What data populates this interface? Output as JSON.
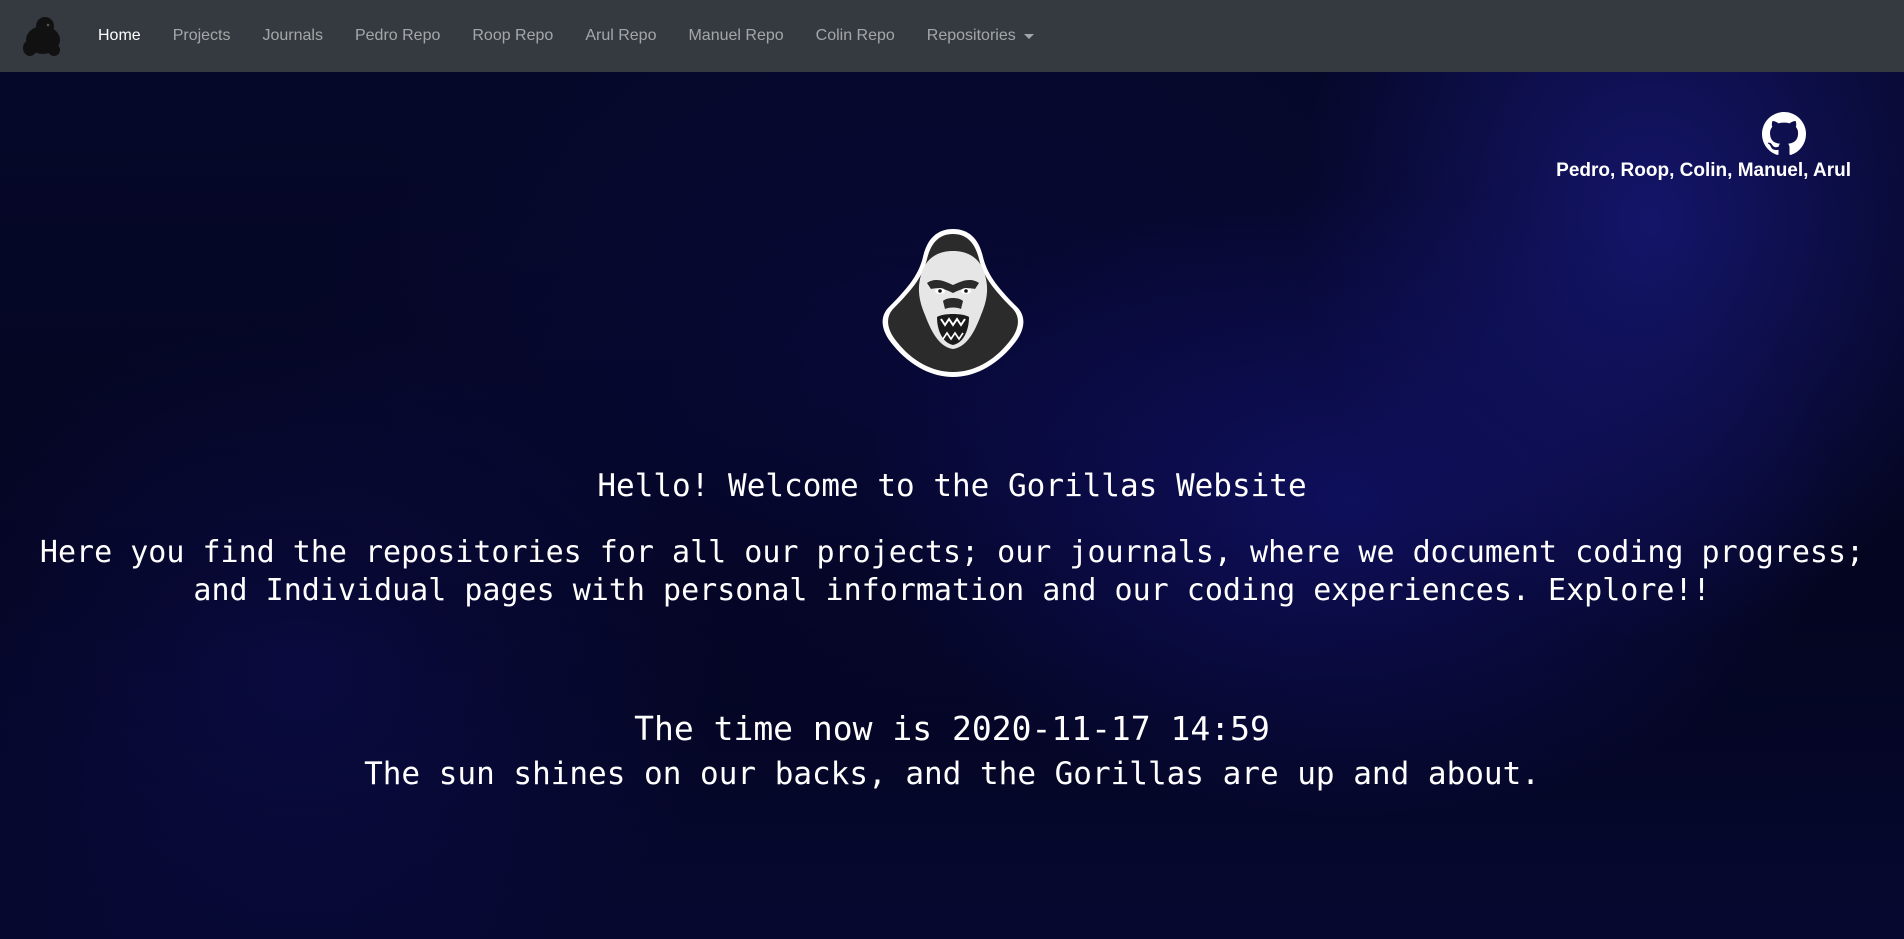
{
  "nav": {
    "brand_icon": "gorilla-icon",
    "items": [
      {
        "label": "Home",
        "active": true
      },
      {
        "label": "Projects",
        "active": false
      },
      {
        "label": "Journals",
        "active": false
      },
      {
        "label": "Pedro Repo",
        "active": false
      },
      {
        "label": "Roop Repo",
        "active": false
      },
      {
        "label": "Arul Repo",
        "active": false
      },
      {
        "label": "Manuel Repo",
        "active": false
      },
      {
        "label": "Colin Repo",
        "active": false
      }
    ],
    "dropdown_label": "Repositories"
  },
  "header": {
    "github_icon": "github-icon",
    "team": "Pedro, Roop, Colin, Manuel, Arul"
  },
  "main": {
    "logo_icon": "gorilla-logo",
    "welcome": "Hello! Welcome to the Gorillas Website",
    "intro": "Here you find the repositories for all our projects; our journals, where we document coding progress; and Individual pages with personal information and our coding experiences. Explore!!",
    "time": "The time now is 2020-11-17 14:59",
    "motto": "The sun shines on our backs, and the Gorillas are up and about."
  },
  "colors": {
    "navbar": "#343a40",
    "background": "#050722",
    "text": "#ffffff"
  }
}
